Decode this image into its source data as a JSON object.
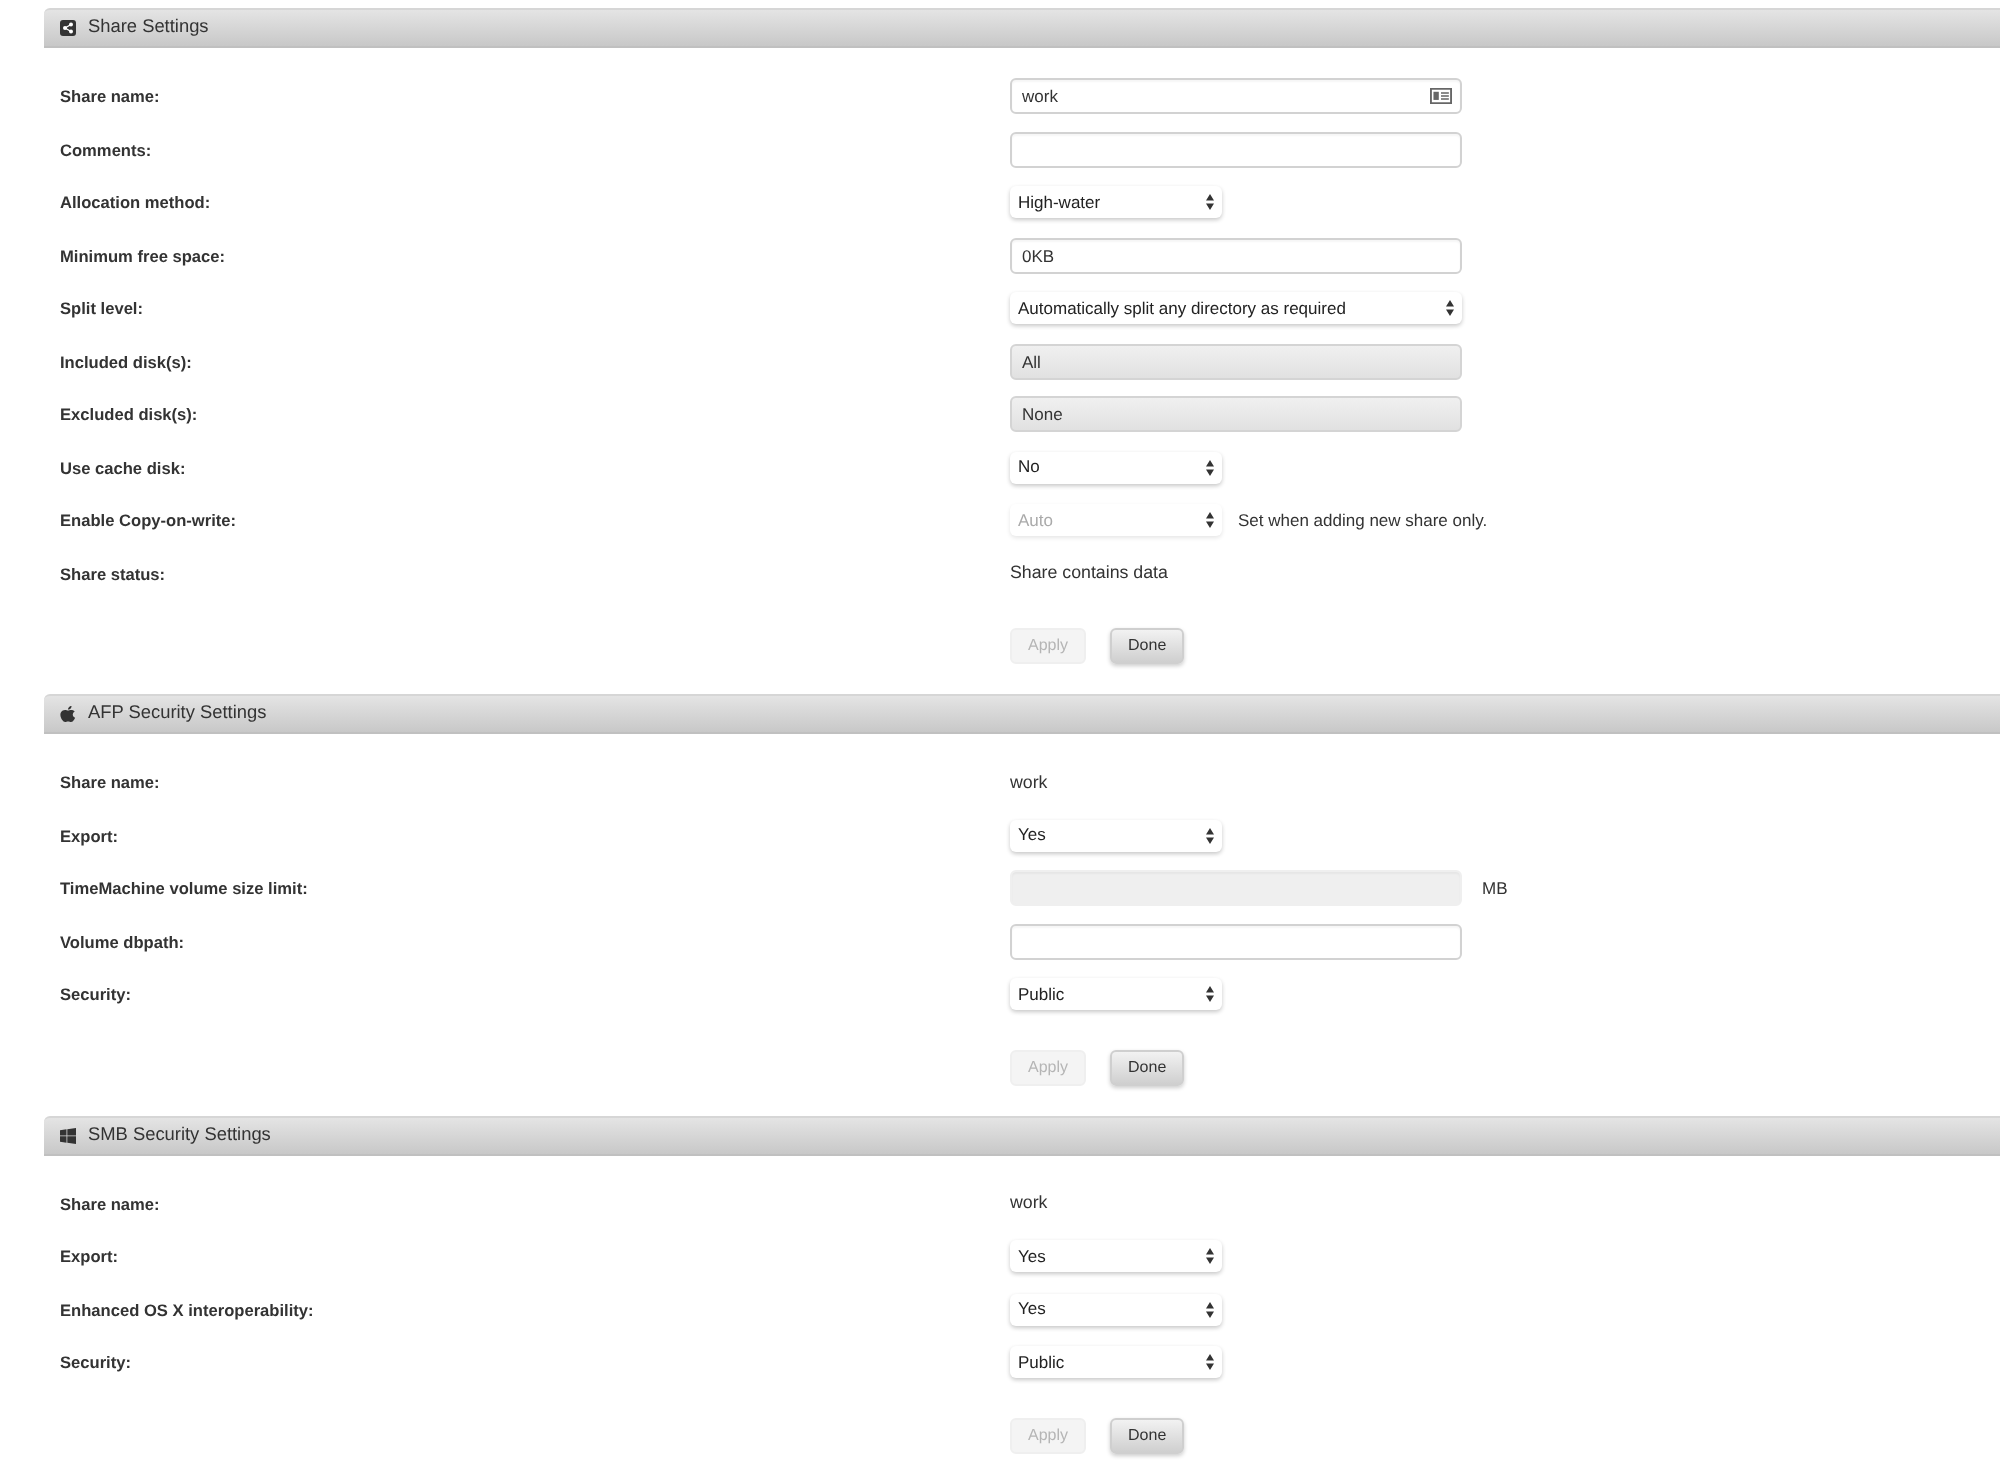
{
  "sections": [
    {
      "kind": "share",
      "title": "Share Settings",
      "rows": [
        {
          "label": "Share name:",
          "kind": "text",
          "value": "work",
          "contact_icon": true,
          "disabled": false
        },
        {
          "label": "Comments:",
          "kind": "text",
          "disabled": false
        },
        {
          "label": "Allocation method:",
          "kind": "select",
          "value": "High-water",
          "disabled": false
        },
        {
          "label": "Minimum free space:",
          "kind": "text",
          "value": "0KB",
          "disabled": false
        },
        {
          "label": "Split level:",
          "kind": "wideselect",
          "value": "Automatically split any directory as required",
          "disabled": false
        },
        {
          "label": "Included disk(s):",
          "kind": "picker",
          "value": "All",
          "disabled": false
        },
        {
          "label": "Excluded disk(s):",
          "kind": "picker",
          "value": "None",
          "disabled": false
        },
        {
          "label": "Use cache disk:",
          "kind": "select",
          "value": "No",
          "disabled": false
        },
        {
          "label": "Enable Copy-on-write:",
          "kind": "select",
          "value": "Auto",
          "disabled": true,
          "note": "Set when adding new share only."
        },
        {
          "label": "Share status:",
          "kind": "static",
          "value": "Share contains data",
          "disabled": false
        }
      ],
      "buttons": [
        {
          "label": "Apply",
          "disabled": true
        },
        {
          "label": "Done",
          "disabled": false
        }
      ]
    },
    {
      "kind": "afp",
      "title": "AFP Security Settings",
      "rows": [
        {
          "label": "Share name:",
          "kind": "static",
          "value": "work",
          "disabled": false
        },
        {
          "label": "Export:",
          "kind": "select",
          "value": "Yes",
          "disabled": false
        },
        {
          "label": "TimeMachine volume size limit:",
          "kind": "text",
          "disabled": true,
          "suffix": "MB"
        },
        {
          "label": "Volume dbpath:",
          "kind": "text",
          "disabled": false
        },
        {
          "label": "Security:",
          "kind": "select",
          "value": "Public",
          "disabled": false
        }
      ],
      "buttons": [
        {
          "label": "Apply",
          "disabled": true
        },
        {
          "label": "Done",
          "disabled": false
        }
      ]
    },
    {
      "kind": "smb",
      "title": "SMB Security Settings",
      "rows": [
        {
          "label": "Share name:",
          "kind": "static",
          "value": "work",
          "disabled": false
        },
        {
          "label": "Export:",
          "kind": "select",
          "value": "Yes",
          "disabled": false
        },
        {
          "label": "Enhanced OS X interoperability:",
          "kind": "select",
          "value": "Yes",
          "disabled": false
        },
        {
          "label": "Security:",
          "kind": "select",
          "value": "Public",
          "disabled": false
        }
      ],
      "buttons": [
        {
          "label": "Apply",
          "disabled": true
        },
        {
          "label": "Done",
          "disabled": false
        }
      ]
    }
  ]
}
